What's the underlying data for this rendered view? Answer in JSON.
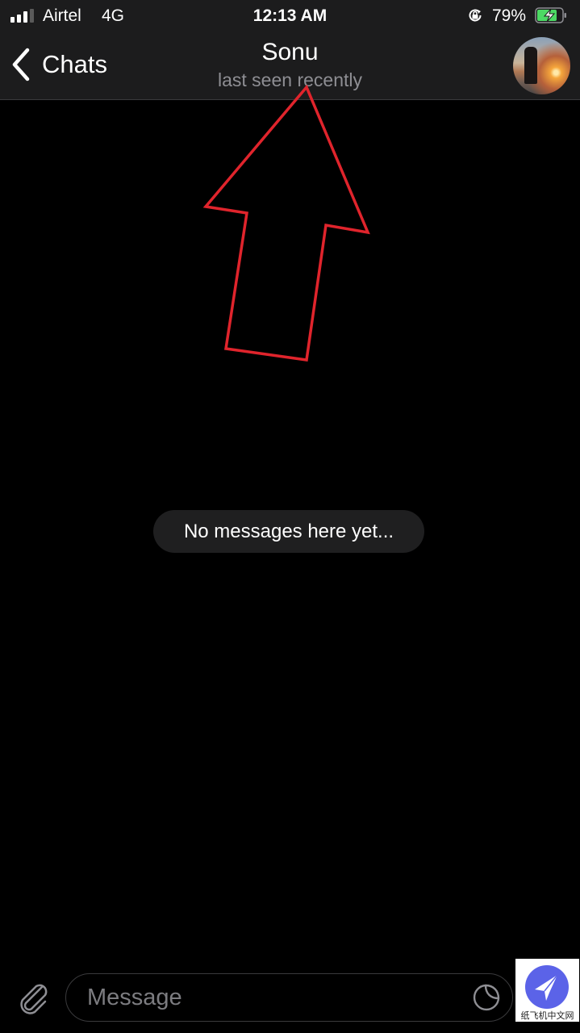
{
  "status_bar": {
    "carrier": "Airtel",
    "network": "4G",
    "time": "12:13 AM",
    "battery_percent": "79%",
    "signal_bars_active": 3,
    "signal_bars_total": 4,
    "icons": [
      "signal-icon",
      "orientation-lock-icon",
      "battery-charging-icon"
    ],
    "battery_color": "#4cd964"
  },
  "nav": {
    "back_label": "Chats",
    "title": "Sonu",
    "subtitle": "last seen recently",
    "icons": [
      "chevron-left-icon",
      "avatar"
    ]
  },
  "chat": {
    "empty_text": "No messages here yet..."
  },
  "annotation": {
    "type": "arrow",
    "color": "#e0242c",
    "points_to": "last seen recently"
  },
  "composer": {
    "placeholder": "Message",
    "value": "",
    "icons": [
      "paperclip-icon",
      "sticker-icon"
    ]
  },
  "watermark": {
    "text": "纸飞机中文网",
    "color": "#5b63e8",
    "icon": "paper-plane-icon"
  }
}
